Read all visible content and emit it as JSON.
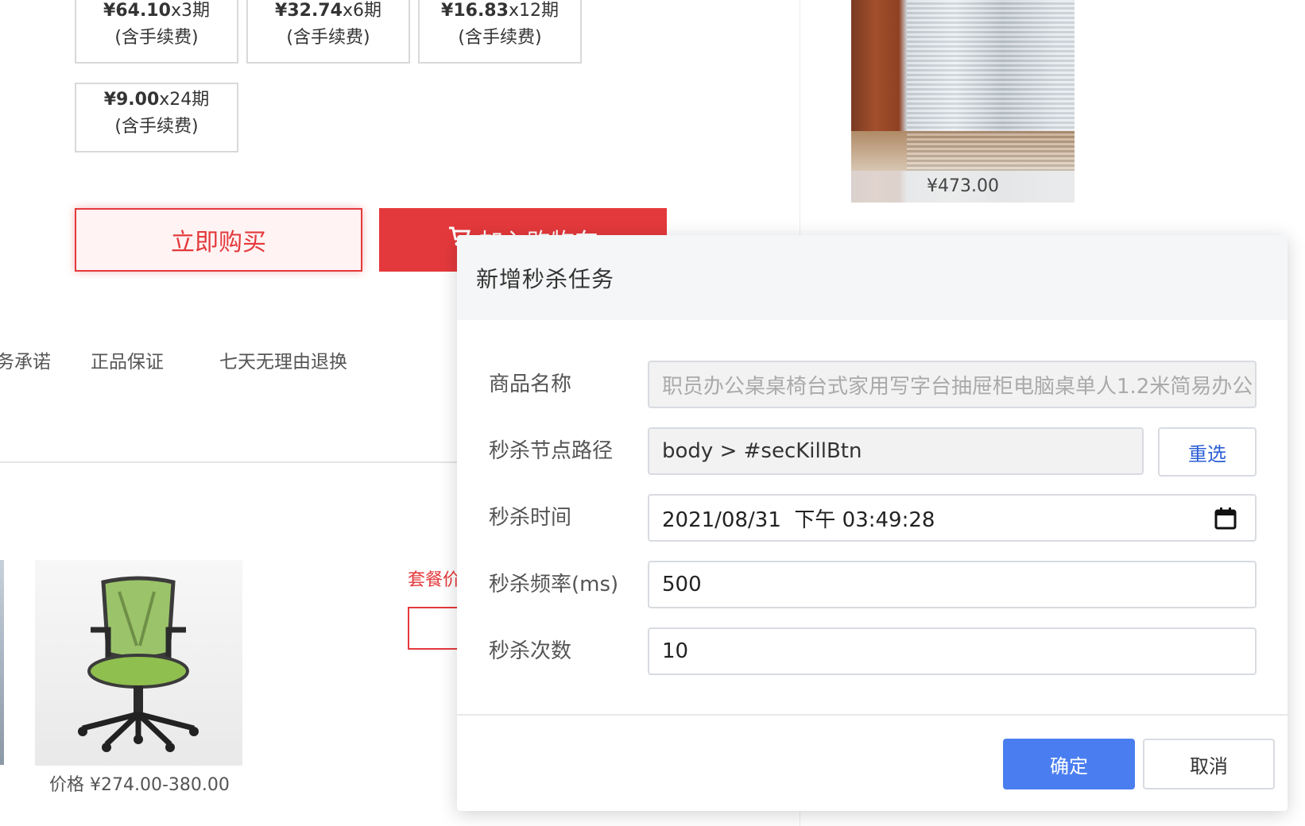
{
  "installments": [
    {
      "amount": "¥64.10",
      "term": "x3期",
      "note": "(含手续费)"
    },
    {
      "amount": "¥32.74",
      "term": "x6期",
      "note": "(含手续费)"
    },
    {
      "amount": "¥16.83",
      "term": "x12期",
      "note": "(含手续费)"
    },
    {
      "amount": "¥9.00",
      "term": "x24期",
      "note": "(含手续费)"
    }
  ],
  "actions": {
    "buy_now": "立即购买",
    "add_to_cart": "加入购物车"
  },
  "services": {
    "promise_label": "服务承诺",
    "item1": "正品保证",
    "item2": "七天无理由退换"
  },
  "related_product": {
    "price": "¥473.00"
  },
  "chair_product": {
    "price": "价格 ¥274.00-380.00"
  },
  "combo": {
    "label": "套餐价"
  },
  "modal": {
    "title": "新增秒杀任务",
    "fields": {
      "product_name": {
        "label": "商品名称",
        "value": "职员办公桌桌椅台式家用写字台抽屉柜电脑桌单人1.2米简易办公"
      },
      "node_path": {
        "label": "秒杀节点路径",
        "value": "body > #secKillBtn",
        "reselect": "重选"
      },
      "time": {
        "label": "秒杀时间",
        "value": "2021/08/31  下午 03:49:28"
      },
      "frequency": {
        "label": "秒杀频率(ms)",
        "value": "500"
      },
      "count": {
        "label": "秒杀次数",
        "value": "10"
      }
    },
    "confirm": "确定",
    "cancel": "取消"
  },
  "icons": {
    "calendar": "calendar-icon",
    "cart": "cart-icon"
  },
  "colors": {
    "brand_red": "#e4393c",
    "primary_blue": "#4a7ef0",
    "link_blue": "#2c5fd6"
  }
}
